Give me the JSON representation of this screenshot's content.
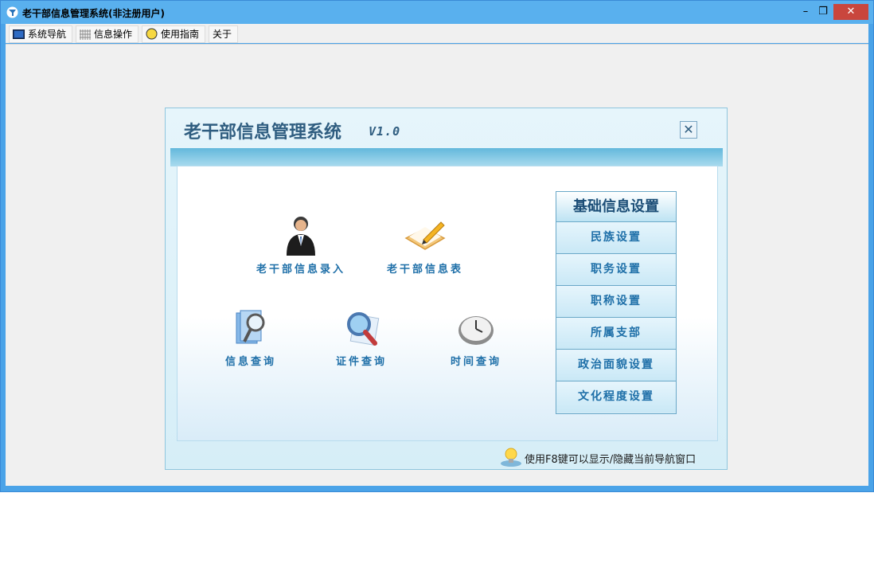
{
  "window": {
    "title": "老干部信息管理系统(非注册用户)",
    "minimize": "–",
    "restore": "❐",
    "close": "✕"
  },
  "menu": [
    {
      "label": "系统导航",
      "icon": "monitor-icon"
    },
    {
      "label": "信息操作",
      "icon": "grid-icon"
    },
    {
      "label": "使用指南",
      "icon": "help-bulb-icon"
    },
    {
      "label": "关于",
      "icon": ""
    }
  ],
  "panel": {
    "title": "老干部信息管理系统",
    "version": "V1.0",
    "close": "✕",
    "nav": [
      {
        "label": "老干部信息录入",
        "icon": "person-icon"
      },
      {
        "label": "老干部信息表",
        "icon": "notebook-pencil-icon"
      },
      {
        "label": "信息查询",
        "icon": "document-magnifier-icon"
      },
      {
        "label": "证件查询",
        "icon": "magnifier-icon"
      },
      {
        "label": "时间查询",
        "icon": "clock-icon"
      }
    ],
    "settings": {
      "header": "基础信息设置",
      "buttons": [
        "民族设置",
        "职务设置",
        "职称设置",
        "所属支部",
        "政治面貌设置",
        "文化程度设置"
      ]
    },
    "tip": "使用F8键可以显示/隐藏当前导航窗口"
  }
}
